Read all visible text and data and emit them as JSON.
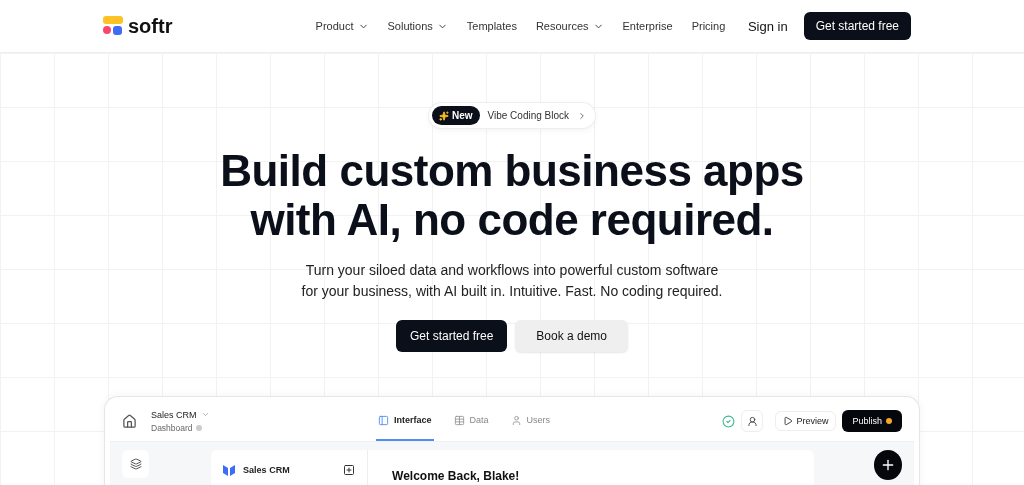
{
  "brand": "softr",
  "nav": [
    {
      "label": "Product",
      "dropdown": true
    },
    {
      "label": "Solutions",
      "dropdown": true
    },
    {
      "label": "Templates",
      "dropdown": false
    },
    {
      "label": "Resources",
      "dropdown": true
    },
    {
      "label": "Enterprise",
      "dropdown": false
    },
    {
      "label": "Pricing",
      "dropdown": false
    }
  ],
  "sign_in": "Sign in",
  "cta": "Get started free",
  "badge": {
    "tag": "New",
    "text": "Vibe Coding Block"
  },
  "headline": [
    "Build custom business apps",
    "with AI, no code required."
  ],
  "subtitle": [
    "Turn your siloed data and workflows into powerful custom software",
    "for your business, with AI built in. Intuitive. Fast. No coding required."
  ],
  "hero_buttons": {
    "primary": "Get started free",
    "secondary": "Book a demo"
  },
  "app": {
    "app_name": "Sales CRM",
    "page_name": "Dashboard",
    "tabs": [
      {
        "label": "Interface",
        "selected": true
      },
      {
        "label": "Data",
        "selected": false
      },
      {
        "label": "Users",
        "selected": false
      }
    ],
    "preview": "Preview",
    "publish": "Publish",
    "sidebar_title": "Sales CRM",
    "welcome": "Welcome Back, Blake!"
  }
}
